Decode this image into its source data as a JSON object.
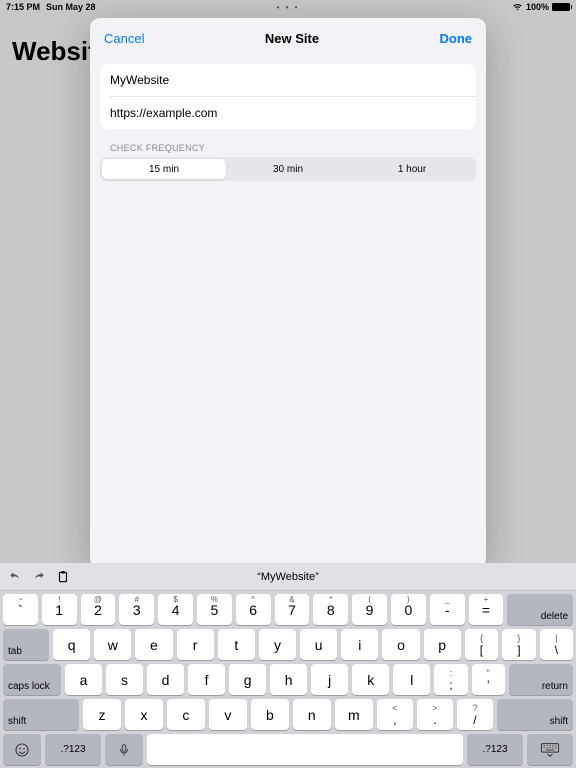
{
  "status": {
    "time": "7:15 PM",
    "date": "Sun May 28",
    "center_dots": "• • •",
    "battery_pct": "100%"
  },
  "page": {
    "title": "Websites"
  },
  "sheet": {
    "cancel": "Cancel",
    "title": "New Site",
    "done": "Done",
    "name_value": "MyWebsite",
    "url_value": "https://example.com",
    "freq_label": "CHECK FREQUENCY",
    "freq_options": [
      "15 min",
      "30 min",
      "1 hour"
    ],
    "freq_selected": 0
  },
  "keyboard": {
    "suggestion": "“MyWebsite”",
    "numbers": [
      {
        "s": "~",
        "m": "`"
      },
      {
        "s": "!",
        "m": "1"
      },
      {
        "s": "@",
        "m": "2"
      },
      {
        "s": "#",
        "m": "3"
      },
      {
        "s": "$",
        "m": "4"
      },
      {
        "s": "%",
        "m": "5"
      },
      {
        "s": "^",
        "m": "6"
      },
      {
        "s": "&",
        "m": "7"
      },
      {
        "s": "*",
        "m": "8"
      },
      {
        "s": "(",
        "m": "9"
      },
      {
        "s": ")",
        "m": "0"
      },
      {
        "s": "_",
        "m": "-"
      },
      {
        "s": "+",
        "m": "="
      }
    ],
    "delete": "delete",
    "tab": "tab",
    "row_q": [
      "q",
      "w",
      "e",
      "r",
      "t",
      "y",
      "u",
      "i",
      "o",
      "p"
    ],
    "brace_l": {
      "u": "{",
      "l": "["
    },
    "brace_r": {
      "u": "}",
      "l": "]"
    },
    "backslash": {
      "u": "|",
      "l": "\\"
    },
    "caps": "caps lock",
    "row_a": [
      "a",
      "s",
      "d",
      "f",
      "g",
      "h",
      "j",
      "k",
      "l"
    ],
    "colon": {
      "u": ":",
      "l": ";"
    },
    "quote": {
      "u": "\"",
      "l": "'"
    },
    "return": "return",
    "shift": "shift",
    "row_z": [
      "z",
      "x",
      "c",
      "v",
      "b",
      "n",
      "m"
    ],
    "comma": {
      "u": "<",
      "l": ","
    },
    "period": {
      "u": ">",
      "l": "."
    },
    "slash": {
      "u": "?",
      "l": "/"
    },
    "mode": ".?123"
  }
}
